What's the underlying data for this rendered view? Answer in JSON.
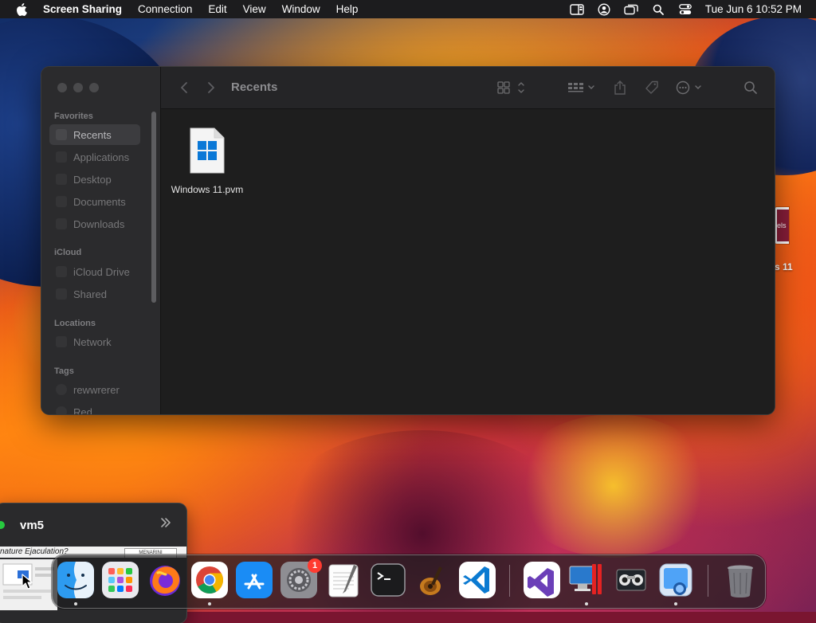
{
  "menubar": {
    "app_name": "Screen Sharing",
    "menus": [
      "Connection",
      "Edit",
      "View",
      "Window",
      "Help"
    ],
    "clock": "Tue Jun 6  10:52 PM",
    "status_icons": [
      "stage-manager-icon",
      "user-icon",
      "screen-mirroring-icon",
      "spotlight-icon",
      "control-center-icon"
    ]
  },
  "finder": {
    "title": "Recents",
    "sidebar": {
      "favorites_header": "Favorites",
      "favorites": [
        "Recents",
        "Applications",
        "Desktop",
        "Documents",
        "Downloads"
      ],
      "icloud_header": "iCloud",
      "icloud": [
        "iCloud Drive",
        "Shared"
      ],
      "locations_header": "Locations",
      "locations": [
        "Network"
      ],
      "tags_header": "Tags",
      "tags": [
        "rewwrerer",
        "Red"
      ]
    },
    "files": [
      {
        "name": "Windows 11.pvm",
        "icon": "windows-document-icon"
      }
    ]
  },
  "desktop": {
    "partial_item_thumb": "els",
    "partial_item_label": "s 11"
  },
  "vm_window": {
    "title": "vm5",
    "strip_text": "nature Ejaculation?",
    "strip_logo": "MENARINI"
  },
  "dock": {
    "apps": [
      "Finder",
      "Launchpad",
      "Firefox",
      "Google Chrome",
      "App Store",
      "System Settings",
      "TextEdit",
      "Terminal",
      "Instruments",
      "Visual Studio Code",
      "Visual Studio",
      "Parallels Desktop",
      "Screen Sharing",
      "Preview",
      "Trash"
    ],
    "settings_badge": "1"
  },
  "colors": {
    "menubar": "#1c1c1e",
    "finder_bg": "#1e1e1e",
    "sidebar_bg": "#2b2b2d",
    "windows_blue": "#0a78d7",
    "badge_red": "#ff3b30"
  }
}
